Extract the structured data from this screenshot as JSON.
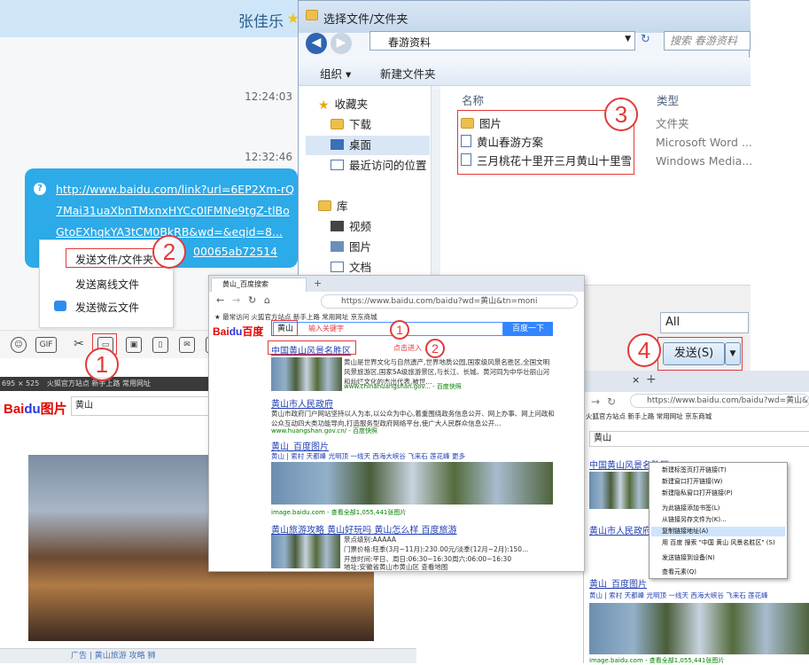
{
  "chat": {
    "title": "张佳乐",
    "time1": "12:24:03",
    "time2": "12:32:46",
    "link_text": "http://www.baidu.com/link?url=6EP2Xm-rQ7Mai31uaXbnTMxnxHYCc0IFMNe9tgZ-tlBoGtoEXhqkYA3tCM0BkRB&wd=&eqid=8...",
    "link_tail": "00065ab72514",
    "menu": [
      "发送文件/文件夹",
      "发送离线文件",
      "发送微云文件"
    ],
    "toolbar": [
      "GIF"
    ]
  },
  "explorer": {
    "title": "选择文件/文件夹",
    "path": "春游资料",
    "search_placeholder": "搜索 春游资料",
    "organize": "组织 ▾",
    "new_folder": "新建文件夹",
    "col_name": "名称",
    "col_type": "类型",
    "nav": [
      "收藏夹",
      "下载",
      "桌面",
      "最近访问的位置",
      "库",
      "视频",
      "图片",
      "文档"
    ],
    "files": [
      {
        "name": "图片",
        "type": "文件夹"
      },
      {
        "name": "黄山春游方案",
        "type": "Microsoft Word ..."
      },
      {
        "name": "三月桃花十里开三月黄山十里雪",
        "type": "Windows Media..."
      }
    ],
    "filter": "All",
    "send": "发送(S)"
  },
  "browser": {
    "tab": "黄山_百度搜索",
    "url": "https://www.baidu.com/baidu?wd=黄山&tn=moni",
    "bookmarks": "★ 最常访问  火狐官方站点  新手上路  常用网址  京东商城",
    "query": "黄山",
    "search_btn": "百度一下",
    "ann1": "输入关键字",
    "ann2": "点击进入",
    "results": [
      {
        "title": "中国黄山风景名胜区",
        "text": "黄山是世界文化与自然遗产,世界地质公园,国家级风景名胜区,全国文明风景旅游区,国家5A级旅游景区,与长江、长城、黄河同为中华壮丽山河和灿烂文化的杰出代表,被世...",
        "url": "www.chinahuangshan.gov... - 百度快照"
      },
      {
        "title": "黄山市人民政府",
        "text": "黄山市政府门户网站坚持以人为本,以公众为中心,着重围绕政务信息公开、网上办事、网上问政和公众互动四大类功能导向,打造服务型政府网络平台,使广大人民群众信息公开...",
        "url": "www.huangshan.gov.cn/ - 百度快照"
      },
      {
        "title": "黄山_百度图片",
        "sub": "黄山 | 索村  天都峰  光明顶  一线天  西海大峡谷  飞来石  莲花峰  更多",
        "url": "image.baidu.com - 查看全部1,055,441张图片"
      },
      {
        "title": "黄山旅游攻略  黄山好玩吗  黄山怎么样  百度旅游",
        "lines": [
          "景点级别:AAAAA",
          "门票价格:旺季(3月~11月):230.00元/淡季(12月~2月):150...",
          "开放时间:平日、周日:06:30~16:30周六:06:00~16:30",
          "地址:安徽省黄山市黄山区  查看地图"
        ]
      }
    ]
  },
  "imgwin": {
    "size": "695 × 525",
    "bookmarks": "火狐官方站点  新手上路  常用网址",
    "query": "黄山",
    "bottom": "广告 | 黄山旅游 攻略 狮"
  },
  "browser2": {
    "url": "https://www.baidu.com/baidu?wd=黄山&tn=mo",
    "bookmarks": "火狐官方站点  新手上路  常用网址  京东商城",
    "query": "黄山",
    "result1": "中国黄山风景名胜区",
    "result2": "黄山市人民政府",
    "result3": "黄山_百度图片",
    "sub3": "黄山 | 索村  天都峰  光明顶  一线天  西海大峡谷  飞来石  莲花峰",
    "url3": "image.baidu.com - 查看全部1,055,441张图片",
    "context_menu": [
      "新建标签页打开链接(T)",
      "新建窗口打开链接(W)",
      "新建隐私窗口打开链接(P)",
      "为此链接添加书签(L)",
      "从链接另存文件为(K)...",
      "复制链接地址(A)",
      "用 百度 搜索 \"中国 黄山 风景名胜区\" (S)",
      "发送链接到设备(N)",
      "查看元素(Q)"
    ]
  },
  "markers": [
    "1",
    "2",
    "3",
    "4",
    "1",
    "2"
  ]
}
